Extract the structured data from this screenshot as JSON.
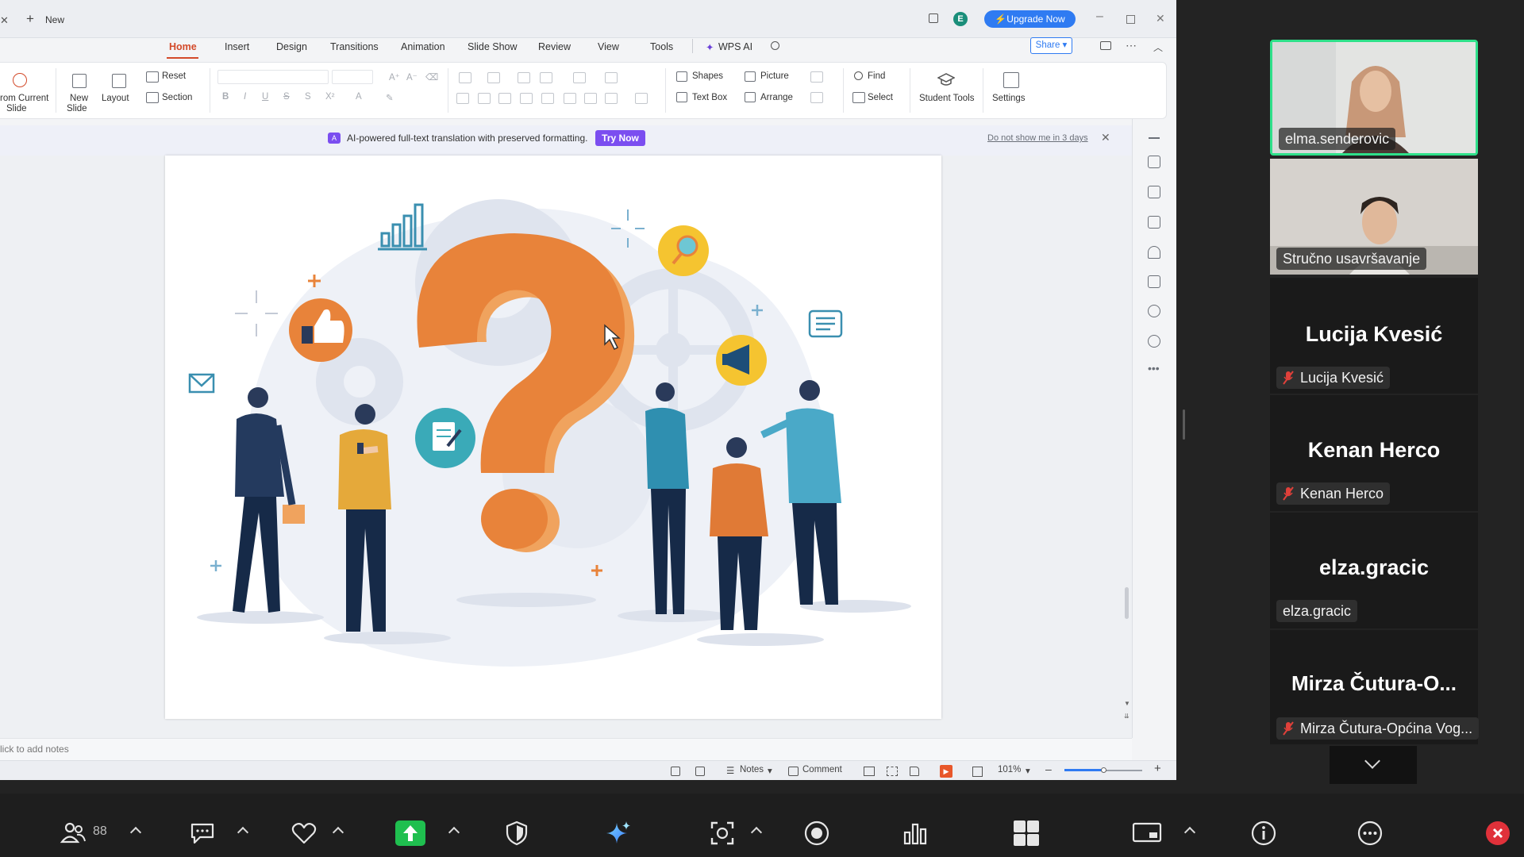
{
  "wps": {
    "tab_new": "New",
    "account_initial": "E",
    "upgrade": "Upgrade Now",
    "share": "Share",
    "menu": [
      "Home",
      "Insert",
      "Design",
      "Transitions",
      "Animation",
      "Slide Show",
      "Review",
      "View",
      "Tools",
      "WPS AI"
    ],
    "ribbon": {
      "from_current": "rom Current",
      "from_current_2": "Slide",
      "new_slide": "New",
      "new_slide_2": "Slide",
      "layout": "Layout",
      "reset": "Reset",
      "section": "Section",
      "shapes": "Shapes",
      "picture": "Picture",
      "text_box": "Text Box",
      "arrange": "Arrange",
      "find": "Find",
      "select": "Select",
      "student_tools": "Student Tools",
      "settings": "Settings"
    },
    "banner": {
      "message": "AI-powered full-text translation with preserved formatting.",
      "cta": "Try Now",
      "dismiss": "Do not show me in 3 days"
    },
    "notes_placeholder": "lick to add notes",
    "status": {
      "notes": "Notes",
      "comment": "Comment",
      "zoom": "101%"
    }
  },
  "participants": [
    {
      "name": "elma.senderovic",
      "video": true,
      "active_speaker": true,
      "muted": false
    },
    {
      "name": "Stručno usavršavanje",
      "video": true,
      "active_speaker": false,
      "muted": false
    },
    {
      "display": "Lucija Kvesić",
      "name": "Lucija Kvesić",
      "muted": true
    },
    {
      "display": "Kenan Herco",
      "name": "Kenan Herco",
      "muted": true
    },
    {
      "display": "elza.gracic",
      "name": "elza.gracic",
      "muted": false
    },
    {
      "display": "Mirza  Čutura-O...",
      "name": "Mirza Čutura-Općina Vog...",
      "muted": true
    }
  ],
  "meeting_bar": {
    "participant_count": "88"
  },
  "colors": {
    "accent_red": "#d34a2a",
    "active_speaker_border": "#2fe08a",
    "share_green": "#1fbf4f",
    "upgrade_blue": "#2f7bf2",
    "try_now_purple": "#7b4ef0"
  }
}
